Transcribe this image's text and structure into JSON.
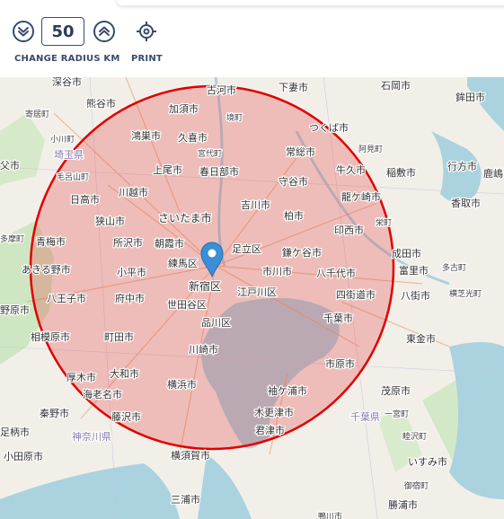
{
  "toolbar": {
    "radius_value": "50",
    "change_radius_label": "CHANGE RADIUS KM",
    "print_label": "PRINT",
    "accent_color": "#3a4a6b"
  },
  "map": {
    "circle_color": "#e00000",
    "marker_color": "#3a8fd6",
    "labels": {
      "l1": "深谷市",
      "l2": "古河市",
      "l3": "下妻市",
      "l4": "石岡市",
      "l5": "鉾田市",
      "l6": "熊谷市",
      "l7": "加須市",
      "l8": "境町",
      "l9": "寄居町",
      "l10": "鴻巣市",
      "l11": "久喜市",
      "l12": "つくば市",
      "l13": "小川町",
      "l14": "阿見町",
      "l15": "埼玉県",
      "l16": "上尾市",
      "l17": "宮代町",
      "l18": "常総市",
      "l19": "父市",
      "l20": "毛呂山町",
      "l21": "春日部市",
      "l22": "牛久市",
      "l23": "稲敷市",
      "l24": "行方市",
      "l25": "日高市",
      "l26": "川越市",
      "l27": "守谷市",
      "l28": "龍ケ崎市",
      "l29": "香取市",
      "l30": "狭山市",
      "l31": "吉川市",
      "l32": "さいたま市",
      "l33": "柏市",
      "l34": "栄町",
      "l35": "多摩町",
      "l36": "青梅市",
      "l37": "所沢市",
      "l38": "朝霞市",
      "l39": "足立区",
      "l40": "印西市",
      "l41": "成田市",
      "l42": "鎌ケ谷市",
      "l43": "練馬区",
      "l44": "富里市",
      "l45": "あきる野市",
      "l46": "小平市",
      "l47": "市川市",
      "l48": "八千代市",
      "l49": "多古町",
      "l50": "新宿区",
      "l51": "八街市",
      "l52": "八王子市",
      "l53": "府中市",
      "l54": "江戸川区",
      "l55": "四街道市",
      "l56": "横芝光町",
      "l57": "野原市",
      "l58": "世田谷区",
      "l59": "千葉市",
      "l60": "品川区",
      "l61": "相模原市",
      "l62": "町田市",
      "l63": "東金市",
      "l64": "川崎市",
      "l65": "市原市",
      "l66": "厚木市",
      "l67": "大和市",
      "l68": "横浜市",
      "l69": "茂原市",
      "l70": "海老名市",
      "l71": "袖ケ浦市",
      "l72": "秦野市",
      "l73": "藤沢市",
      "l74": "木更津市",
      "l75": "一宮町",
      "l76": "千葉県",
      "l77": "足柄市",
      "l78": "神奈川県",
      "l79": "君津市",
      "l80": "睦沢町",
      "l81": "小田原市",
      "l82": "横須賀市",
      "l83": "いすみ市",
      "l84": "御宿町",
      "l85": "三浦市",
      "l86": "勝浦市",
      "l87": "鴨川市",
      "l88": "鹿嶋"
    }
  }
}
